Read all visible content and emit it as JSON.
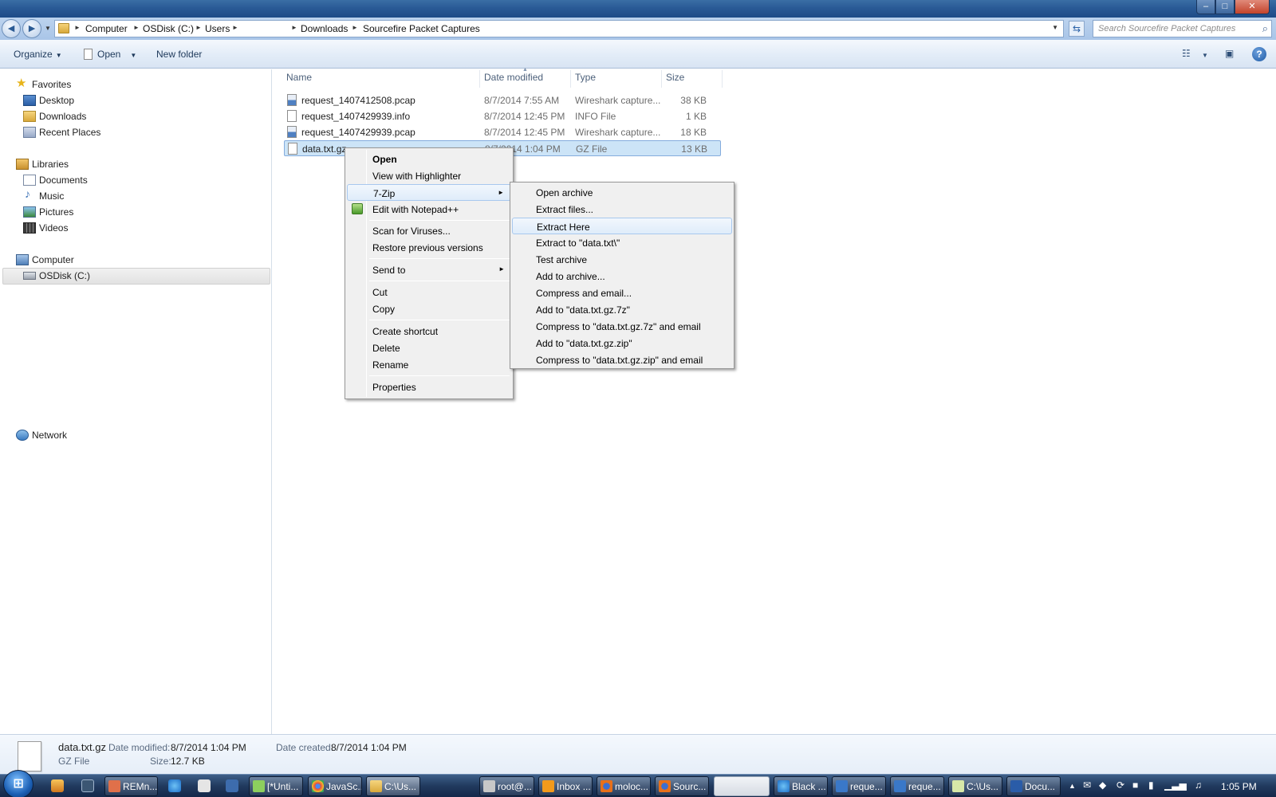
{
  "window": {
    "minimize_glyph": "–",
    "maximize_glyph": "□",
    "close_glyph": "✕"
  },
  "address": {
    "back_glyph": "◄",
    "forward_glyph": "►",
    "crumbs": [
      "Computer",
      "OSDisk (C:)",
      "Users",
      "Downloads",
      "Sourcefire Packet Captures"
    ],
    "search_placeholder": "Search Sourcefire Packet Captures"
  },
  "commandbar": {
    "organize": "Organize",
    "open": "Open",
    "new_folder": "New folder",
    "help": "?"
  },
  "navigation": {
    "favorites": "Favorites",
    "desktop": "Desktop",
    "downloads": "Downloads",
    "recent_places": "Recent Places",
    "libraries": "Libraries",
    "documents": "Documents",
    "music": "Music",
    "pictures": "Pictures",
    "videos": "Videos",
    "computer": "Computer",
    "osdisk": "OSDisk (C:)",
    "network": "Network"
  },
  "columns": {
    "name": "Name",
    "date_modified": "Date modified",
    "type": "Type",
    "size": "Size"
  },
  "files": [
    {
      "name": "request_1407412508.pcap",
      "date": "8/7/2014 7:55 AM",
      "type": "Wireshark capture...",
      "size": "38 KB",
      "icon": "wireshark-file-icon"
    },
    {
      "name": "request_1407429939.info",
      "date": "8/7/2014 12:45 PM",
      "type": "INFO File",
      "size": "1 KB",
      "icon": "file-icon"
    },
    {
      "name": "request_1407429939.pcap",
      "date": "8/7/2014 12:45 PM",
      "type": "Wireshark capture...",
      "size": "18 KB",
      "icon": "wireshark-file-icon"
    },
    {
      "name": "data.txt.gz",
      "date": "8/7/2014 1:04 PM",
      "type": "GZ File",
      "size": "13 KB",
      "icon": "file-icon",
      "selected": true
    }
  ],
  "context_menu": {
    "open": "Open",
    "view_with_highlighter": "View with Highlighter",
    "seven_zip": "7-Zip",
    "edit_with_notepadpp": "Edit with Notepad++",
    "scan_for_viruses": "Scan for Viruses...",
    "restore_previous_versions": "Restore previous versions",
    "send_to": "Send to",
    "cut": "Cut",
    "copy": "Copy",
    "create_shortcut": "Create shortcut",
    "delete": "Delete",
    "rename": "Rename",
    "properties": "Properties"
  },
  "seven_zip_menu": {
    "open_archive": "Open archive",
    "extract_files": "Extract files...",
    "extract_here": "Extract Here",
    "extract_to": "Extract to \"data.txt\\\"",
    "test_archive": "Test archive",
    "add_to_archive": "Add to archive...",
    "compress_and_email": "Compress and email...",
    "add_to_7z": "Add to \"data.txt.gz.7z\"",
    "compress_7z_email": "Compress to \"data.txt.gz.7z\" and email",
    "add_to_zip": "Add to \"data.txt.gz.zip\"",
    "compress_zip_email": "Compress to \"data.txt.gz.zip\" and email"
  },
  "details": {
    "filename": "data.txt.gz",
    "filetype": "GZ File",
    "date_modified_label": "Date modified:",
    "date_modified": "8/7/2014 1:04 PM",
    "size_label": "Size:",
    "size": "12.7 KB",
    "date_created_label": "Date created:",
    "date_created": "8/7/2014 1:04 PM"
  },
  "taskbar": {
    "buttons": [
      "REMn...",
      "[*Unti...",
      "JavaSc...",
      "C:\\Us...",
      "root@...",
      "Inbox ...",
      "moloc...",
      "Sourc...",
      "",
      "Black ...",
      "reque...",
      "reque...",
      "C:\\Us...",
      "Docu..."
    ],
    "clock": "1:05 PM"
  },
  "colors": {
    "selection_bg": "#cce4f7",
    "selection_border": "#84acdd",
    "taskbar": "#213a5e",
    "menu_bg": "#f0f0f0"
  }
}
